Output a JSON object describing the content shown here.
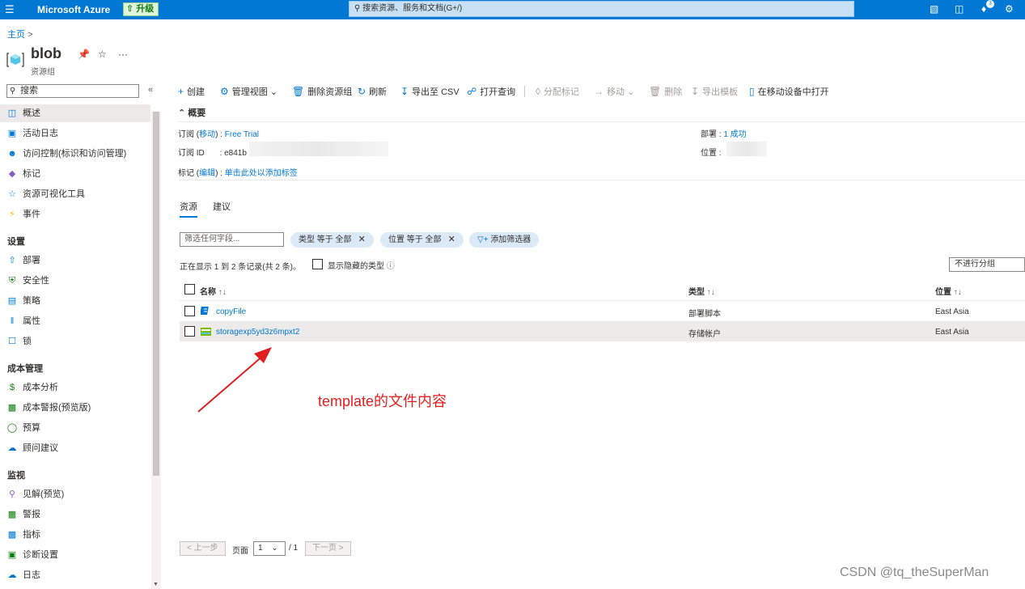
{
  "topbar": {
    "brand": "Microsoft Azure",
    "upgrade": "升级",
    "search_placeholder": "搜索资源、服务和文档(G+/)",
    "notification_count": "3"
  },
  "breadcrumb": {
    "home": "主页",
    "sep": ">"
  },
  "resource": {
    "title": "blob",
    "subtitle": "资源组"
  },
  "sidebar": {
    "search": "搜索",
    "items_top": [
      {
        "label": "概述",
        "icon": "resource-group-icon"
      },
      {
        "label": "活动日志",
        "icon": "log-icon"
      },
      {
        "label": "访问控制(标识和访问管理)",
        "icon": "people-icon"
      },
      {
        "label": "标记",
        "icon": "tag-icon"
      },
      {
        "label": "资源可视化工具",
        "icon": "visualizer-icon"
      },
      {
        "label": "事件",
        "icon": "lightning-icon"
      }
    ],
    "section_settings": "设置",
    "items_settings": [
      {
        "label": "部署",
        "icon": "deploy-icon"
      },
      {
        "label": "安全性",
        "icon": "shield-icon"
      },
      {
        "label": "策略",
        "icon": "policy-icon"
      },
      {
        "label": "属性",
        "icon": "properties-icon"
      },
      {
        "label": "锁",
        "icon": "lock-icon"
      }
    ],
    "section_cost": "成本管理",
    "items_cost": [
      {
        "label": "成本分析",
        "icon": "cost-icon"
      },
      {
        "label": "成本警报(预览版)",
        "icon": "alert-icon"
      },
      {
        "label": "预算",
        "icon": "budget-icon"
      },
      {
        "label": "顾问建议",
        "icon": "advisor-icon"
      }
    ],
    "section_monitor": "监视",
    "items_monitor": [
      {
        "label": "见解(预览)",
        "icon": "insights-icon"
      },
      {
        "label": "警报",
        "icon": "alerts-icon"
      },
      {
        "label": "指标",
        "icon": "metrics-icon"
      },
      {
        "label": "诊断设置",
        "icon": "diagnostics-icon"
      },
      {
        "label": "日志",
        "icon": "logs-icon"
      }
    ]
  },
  "toolbar": {
    "create": "创建",
    "manage_view": "管理视图",
    "delete_rg": "删除资源组",
    "refresh": "刷新",
    "export_csv": "导出至 CSV",
    "open_query": "打开查询",
    "assign_tags": "分配标记",
    "move": "移动",
    "delete": "删除",
    "export_template": "导出模板",
    "open_mobile": "在移动设备中打开"
  },
  "essentials": {
    "title": "概要",
    "subscription_label": "订阅",
    "move_link": "移动",
    "subscription_value": "Free Trial",
    "subscription_id_label": "订阅 ID",
    "subscription_id_value": "e841b",
    "tags_label": "标记",
    "edit_link": "编辑",
    "tags_link": "单击此处以添加标签",
    "deployments_label": "部署",
    "deployments_value": "1 成功",
    "location_label": "位置"
  },
  "tabs": {
    "resources": "资源",
    "recommendations": "建议"
  },
  "filters": {
    "placeholder": "筛选任何字段...",
    "type_pill": "类型 等于 全部",
    "location_pill": "位置 等于 全部",
    "add_filter": "添加筛选器"
  },
  "records": {
    "count_text": "正在显示 1 到 2 条记录(共 2 条)。",
    "show_hidden": "显示隐藏的类型",
    "group_by": "不进行分组"
  },
  "table": {
    "headers": {
      "name": "名称",
      "type": "类型",
      "location": "位置"
    },
    "rows": [
      {
        "name": "copyFile",
        "type": "部署脚本",
        "location": "East Asia",
        "icon": "deployment-script-icon"
      },
      {
        "name": "storagexp5yd3z6mpxt2",
        "type": "存储帐户",
        "location": "East Asia",
        "icon": "storage-account-icon"
      }
    ]
  },
  "annotation": "template的文件内容",
  "pager": {
    "prev": "< 上一步",
    "page_label": "页面",
    "page_value": "1",
    "total": "/ 1",
    "next": "下一页 >"
  },
  "watermark": "CSDN @tq_theSuperMan",
  "colors": {
    "azure_blue": "#0078d4",
    "annotation_red": "#e02020"
  }
}
